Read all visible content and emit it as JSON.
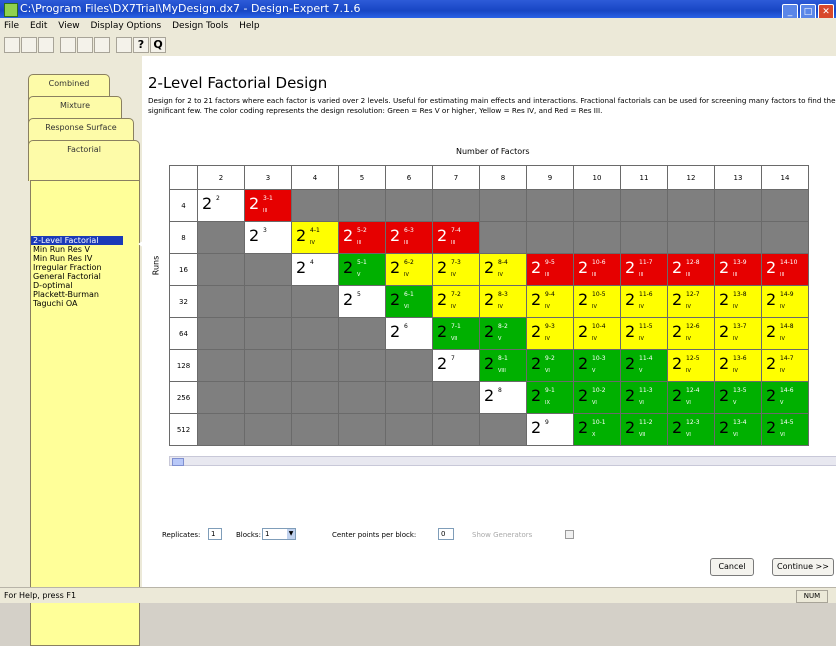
{
  "window": {
    "title": "C:\\Program Files\\DX7Trial\\MyDesign.dx7 - Design-Expert 7.1.6"
  },
  "menu": [
    "File",
    "Edit",
    "View",
    "Display Options",
    "Design Tools",
    "Help"
  ],
  "toolbar": {
    "help_glyph": "?",
    "tip_glyph": "Q"
  },
  "tabs": [
    "Combined",
    "Mixture",
    "Response Surface",
    "Factorial"
  ],
  "design_list": [
    "2-Level Factorial",
    "Min Run Res V",
    "Min Run Res IV",
    "Irregular Fraction",
    "General Factorial",
    "D-optimal",
    "Plackett-Burman",
    "Taguchi OA"
  ],
  "selected_design": "2-Level Factorial",
  "main": {
    "title": "2-Level Factorial Design",
    "description": "Design for 2 to 21 factors where each factor is varied over 2 levels.  Useful for estimating main effects and interactions.  Fractional factorials can be used for screening many factors to find the significant few.  The color coding represents the design resolution: Green = Res V or higher, Yellow = Res IV, and Red = Res III.",
    "columns_label": "Number of Factors",
    "rows_label": "Runs"
  },
  "grid": {
    "factors": [
      "2",
      "3",
      "4",
      "5",
      "6",
      "7",
      "8",
      "9",
      "10",
      "11",
      "12",
      "13",
      "14"
    ],
    "runs": [
      "4",
      "8",
      "16",
      "32",
      "64",
      "128",
      "256",
      "512"
    ],
    "colors": {
      "white": "#ffffff",
      "gray": "#7f7f7f",
      "red": "#e60000",
      "yellow": "#ffff00",
      "green": "#00b000"
    },
    "rows": [
      [
        [
          "w",
          "2",
          "2",
          ""
        ],
        [
          "r",
          "2",
          "3-1",
          "III"
        ],
        [
          "g"
        ],
        [
          "g"
        ],
        [
          "g"
        ],
        [
          "g"
        ],
        [
          "g"
        ],
        [
          "g"
        ],
        [
          "g"
        ],
        [
          "g"
        ],
        [
          "g"
        ],
        [
          "g"
        ],
        [
          "g"
        ]
      ],
      [
        [
          "g"
        ],
        [
          "w",
          "2",
          "3",
          ""
        ],
        [
          "y",
          "2",
          "4-1",
          "IV"
        ],
        [
          "r",
          "2",
          "5-2",
          "III"
        ],
        [
          "r",
          "2",
          "6-3",
          "III"
        ],
        [
          "r",
          "2",
          "7-4",
          "III"
        ],
        [
          "g"
        ],
        [
          "g"
        ],
        [
          "g"
        ],
        [
          "g"
        ],
        [
          "g"
        ],
        [
          "g"
        ],
        [
          "g"
        ]
      ],
      [
        [
          "g"
        ],
        [
          "g"
        ],
        [
          "w",
          "2",
          "4",
          ""
        ],
        [
          "G",
          "2",
          "5-1",
          "V"
        ],
        [
          "y",
          "2",
          "6-2",
          "IV"
        ],
        [
          "y",
          "2",
          "7-3",
          "IV"
        ],
        [
          "y",
          "2",
          "8-4",
          "IV"
        ],
        [
          "r",
          "2",
          "9-5",
          "III"
        ],
        [
          "r",
          "2",
          "10-6",
          "III"
        ],
        [
          "r",
          "2",
          "11-7",
          "III"
        ],
        [
          "r",
          "2",
          "12-8",
          "III"
        ],
        [
          "r",
          "2",
          "13-9",
          "III"
        ],
        [
          "r",
          "2",
          "14-10",
          "III"
        ]
      ],
      [
        [
          "g"
        ],
        [
          "g"
        ],
        [
          "g"
        ],
        [
          "w",
          "2",
          "5",
          ""
        ],
        [
          "G",
          "2",
          "6-1",
          "VI"
        ],
        [
          "y",
          "2",
          "7-2",
          "IV"
        ],
        [
          "y",
          "2",
          "8-3",
          "IV"
        ],
        [
          "y",
          "2",
          "9-4",
          "IV"
        ],
        [
          "y",
          "2",
          "10-5",
          "IV"
        ],
        [
          "y",
          "2",
          "11-6",
          "IV"
        ],
        [
          "y",
          "2",
          "12-7",
          "IV"
        ],
        [
          "y",
          "2",
          "13-8",
          "IV"
        ],
        [
          "y",
          "2",
          "14-9",
          "IV"
        ]
      ],
      [
        [
          "g"
        ],
        [
          "g"
        ],
        [
          "g"
        ],
        [
          "g"
        ],
        [
          "w",
          "2",
          "6",
          ""
        ],
        [
          "G",
          "2",
          "7-1",
          "VII"
        ],
        [
          "G",
          "2",
          "8-2",
          "V"
        ],
        [
          "y",
          "2",
          "9-3",
          "IV"
        ],
        [
          "y",
          "2",
          "10-4",
          "IV"
        ],
        [
          "y",
          "2",
          "11-5",
          "IV"
        ],
        [
          "y",
          "2",
          "12-6",
          "IV"
        ],
        [
          "y",
          "2",
          "13-7",
          "IV"
        ],
        [
          "y",
          "2",
          "14-8",
          "IV"
        ]
      ],
      [
        [
          "g"
        ],
        [
          "g"
        ],
        [
          "g"
        ],
        [
          "g"
        ],
        [
          "g"
        ],
        [
          "w",
          "2",
          "7",
          ""
        ],
        [
          "G",
          "2",
          "8-1",
          "VIII"
        ],
        [
          "G",
          "2",
          "9-2",
          "VI"
        ],
        [
          "G",
          "2",
          "10-3",
          "V"
        ],
        [
          "G",
          "2",
          "11-4",
          "V"
        ],
        [
          "y",
          "2",
          "12-5",
          "IV"
        ],
        [
          "y",
          "2",
          "13-6",
          "IV"
        ],
        [
          "y",
          "2",
          "14-7",
          "IV"
        ]
      ],
      [
        [
          "g"
        ],
        [
          "g"
        ],
        [
          "g"
        ],
        [
          "g"
        ],
        [
          "g"
        ],
        [
          "g"
        ],
        [
          "w",
          "2",
          "8",
          ""
        ],
        [
          "G",
          "2",
          "9-1",
          "IX"
        ],
        [
          "G",
          "2",
          "10-2",
          "VI"
        ],
        [
          "G",
          "2",
          "11-3",
          "VI"
        ],
        [
          "G",
          "2",
          "12-4",
          "VI"
        ],
        [
          "G",
          "2",
          "13-5",
          "V"
        ],
        [
          "G",
          "2",
          "14-6",
          "V"
        ]
      ],
      [
        [
          "g"
        ],
        [
          "g"
        ],
        [
          "g"
        ],
        [
          "g"
        ],
        [
          "g"
        ],
        [
          "g"
        ],
        [
          "g"
        ],
        [
          "w",
          "2",
          "9",
          ""
        ],
        [
          "G",
          "2",
          "10-1",
          "X"
        ],
        [
          "G",
          "2",
          "11-2",
          "VII"
        ],
        [
          "G",
          "2",
          "12-3",
          "VI"
        ],
        [
          "G",
          "2",
          "13-4",
          "VI"
        ],
        [
          "G",
          "2",
          "14-5",
          "VI"
        ]
      ]
    ]
  },
  "controls": {
    "replicates_label": "Replicates:",
    "replicates_value": "1",
    "blocks_label": "Blocks:",
    "blocks_value": "1",
    "center_points_label": "Center points per block:",
    "center_points_value": "0",
    "show_generators_label": "Show Generators"
  },
  "buttons": {
    "cancel": "Cancel",
    "continue": "Continue >>"
  },
  "status": {
    "help": "For Help, press F1",
    "num": "NUM"
  }
}
